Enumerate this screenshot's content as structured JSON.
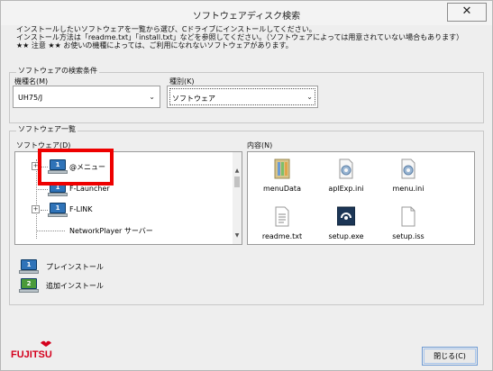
{
  "window": {
    "title": "ソフトウェアディスク検索",
    "close_glyph": "✕"
  },
  "intro": {
    "line1": "インストールしたいソフトウェアを一覧から選び、Cドライブにインストールしてください。",
    "line2": "インストール方法は「readme.txt」「install.txt」などを参照してください。（ソフトウェアによっては用意されていない場合もあります）",
    "line3": "★★ 注意 ★★ お使いの機種によっては、ご利用になれないソフトウェアがあります。"
  },
  "search": {
    "group_label": "ソフトウェアの検索条件",
    "model_label": "機種名(M)",
    "model_value": "UH75/J",
    "type_label": "種別(K)",
    "type_value": "ソフトウェア",
    "chevron": "⌄"
  },
  "software_list": {
    "group_label": "ソフトウェア一覧",
    "tree_label": "ソフトウェア(D)",
    "items": [
      {
        "label": "@メニュー",
        "badge": "1",
        "expander": "+"
      },
      {
        "label": "F-Launcher",
        "badge": "1",
        "expander": ""
      },
      {
        "label": "F-LINK",
        "badge": "1",
        "expander": "+"
      },
      {
        "label": "NetworkPlayer サーバー",
        "badge": "",
        "expander": ""
      }
    ],
    "scroll_up": "▲",
    "scroll_down": "▼"
  },
  "contents": {
    "label": "内容(N)",
    "files": [
      {
        "name": "menuData",
        "icon": "folder-icon"
      },
      {
        "name": "aplExp.ini",
        "icon": "settings-file-icon"
      },
      {
        "name": "menu.ini",
        "icon": "settings-file-icon"
      },
      {
        "name": "readme.txt",
        "icon": "text-file-icon"
      },
      {
        "name": "setup.exe",
        "icon": "setup-exe-icon"
      },
      {
        "name": "setup.iss",
        "icon": "blank-file-icon"
      }
    ]
  },
  "legend": {
    "preinstall_label": "プレインストール",
    "preinstall_badge": "1",
    "add_install_label": "追加インストール",
    "add_install_badge": "2"
  },
  "logo_text": "FUJITSU",
  "close_button_label": "閉じる(C)",
  "colors": {
    "preinstall_screen": "#2f73b8",
    "add_install_screen": "#4a9a3a",
    "highlight": "#ee0000",
    "logo": "#d4001d"
  }
}
